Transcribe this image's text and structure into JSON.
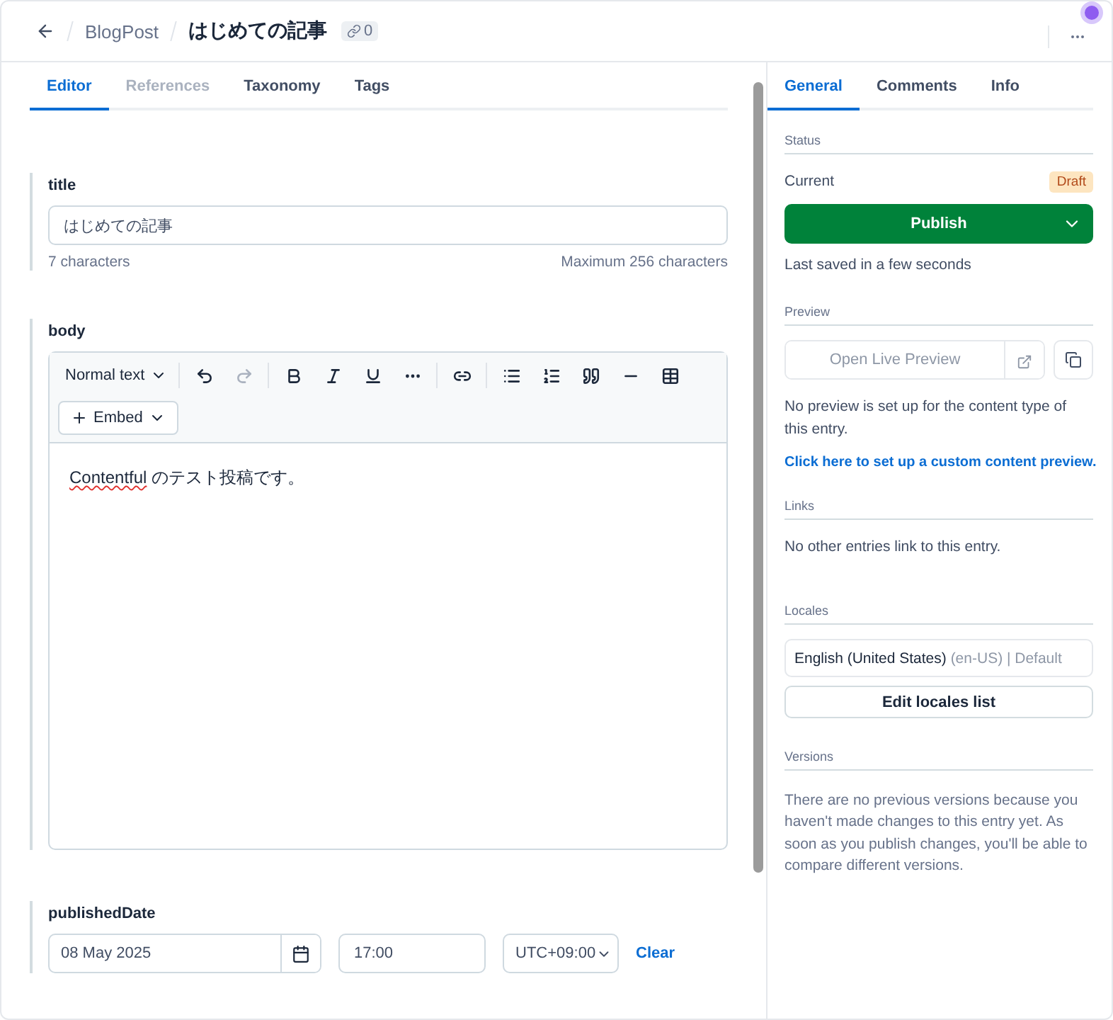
{
  "header": {
    "breadcrumb": "BlogPost",
    "title": "はじめての記事",
    "link_count": "0"
  },
  "editor_tabs": [
    {
      "label": "Editor",
      "selected": true,
      "disabled": false
    },
    {
      "label": "References",
      "selected": false,
      "disabled": true
    },
    {
      "label": "Taxonomy",
      "selected": false,
      "disabled": false
    },
    {
      "label": "Tags",
      "selected": false,
      "disabled": false
    }
  ],
  "title_field": {
    "label": "title",
    "value": "はじめての記事",
    "count": "7 characters",
    "limit": "Maximum 256 characters"
  },
  "body_field": {
    "label": "body",
    "format": "Normal text",
    "toolbar_groups": [
      [
        {
          "kind": "undo",
          "disabled": false
        },
        {
          "kind": "redo",
          "disabled": true
        }
      ],
      [
        {
          "kind": "bold",
          "disabled": false
        },
        {
          "kind": "italic",
          "disabled": false
        },
        {
          "kind": "underline",
          "disabled": false
        },
        {
          "kind": "more",
          "disabled": false
        }
      ],
      [
        {
          "kind": "link",
          "disabled": false
        }
      ],
      [
        {
          "kind": "bullets",
          "disabled": false
        },
        {
          "kind": "numbers",
          "disabled": false
        },
        {
          "kind": "quote",
          "disabled": false
        },
        {
          "kind": "rule",
          "disabled": false
        },
        {
          "kind": "table",
          "disabled": false
        }
      ]
    ],
    "embed": "Embed",
    "content": [
      {
        "text": "Contentful",
        "misspelled": true
      },
      {
        "text": " のテスト投稿です。",
        "misspelled": false
      }
    ]
  },
  "date_field": {
    "label": "publishedDate",
    "date": "08 May 2025",
    "time": "17:00",
    "timezone": "UTC+09:00",
    "clear": "Clear"
  },
  "side_tabs": [
    {
      "label": "General",
      "selected": true
    },
    {
      "label": "Comments",
      "selected": false
    },
    {
      "label": "Info",
      "selected": false
    }
  ],
  "status": {
    "heading": "Status",
    "current_label": "Current",
    "badge": "Draft",
    "publish": "Publish",
    "saved": "Last saved in a few seconds"
  },
  "preview": {
    "heading": "Preview",
    "open": "Open Live Preview",
    "note": "No preview is set up for the content type of this entry.",
    "link": "Click here to set up a custom content preview."
  },
  "links": {
    "heading": "Links",
    "note": "No other entries link to this entry."
  },
  "locales": {
    "heading": "Locales",
    "name": "English (United States)",
    "detail": "(en-US) | Default",
    "edit": "Edit locales list"
  },
  "versions": {
    "heading": "Versions",
    "note": "There are no previous versions because you haven't made changes to this entry yet. As soon as you publish changes, you'll be able to compare different versions."
  }
}
